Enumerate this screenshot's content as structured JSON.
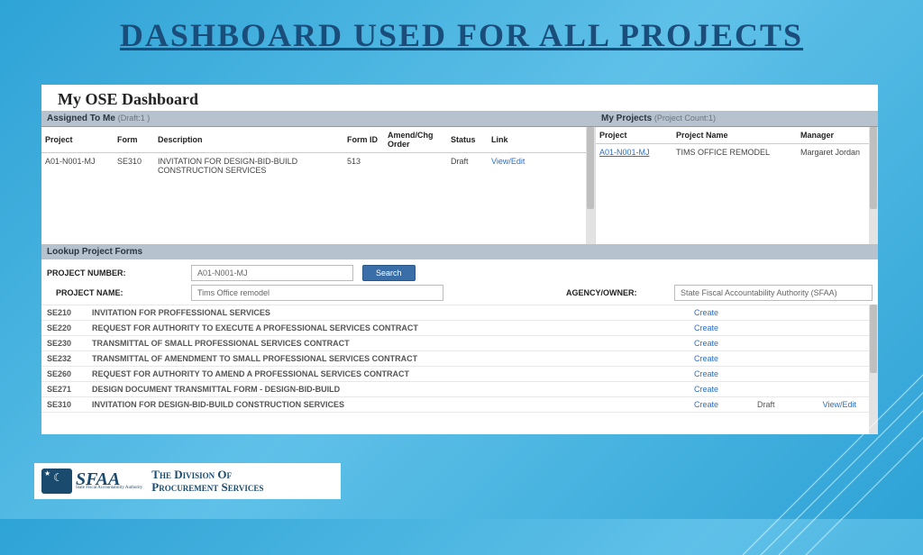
{
  "slide_title": "DASHBOARD USED FOR ALL PROJECTS",
  "dashboard_title": "My OSE Dashboard",
  "assigned": {
    "header": "Assigned To Me",
    "header_muted": "(Draft:1  )",
    "cols": [
      "Project",
      "Form",
      "Description",
      "Form ID",
      "Amend/Chg Order",
      "Status",
      "Link"
    ],
    "rows": [
      {
        "project": "A01-N001-MJ",
        "form": "SE310",
        "description": "INVITATION FOR DESIGN-BID-BUILD CONSTRUCTION SERVICES",
        "form_id": "513",
        "amend": "",
        "status": "Draft",
        "link": "View/Edit"
      }
    ]
  },
  "myprojects": {
    "header": "My Projects",
    "header_muted": "(Project Count:1)",
    "cols": [
      "Project",
      "Project Name",
      "Manager"
    ],
    "rows": [
      {
        "project": "A01-N001-MJ",
        "name": "TIMS OFFICE REMODEL",
        "manager": "Margaret Jordan"
      }
    ]
  },
  "lookup": {
    "header": "Lookup Project Forms",
    "labels": {
      "project_number": "PROJECT NUMBER:",
      "project_name": "PROJECT NAME:",
      "agency_owner": "AGENCY/OWNER:"
    },
    "values": {
      "project_number": "A01-N001-MJ",
      "project_name": "Tims Office remodel",
      "agency_owner": "State Fiscal Accountability Authority (SFAA)"
    },
    "search_label": "Search"
  },
  "forms": [
    {
      "code": "SE210",
      "desc": "INVITATION FOR PROFFESSIONAL SERVICES",
      "action": "Create",
      "status": "",
      "view": ""
    },
    {
      "code": "SE220",
      "desc": "REQUEST FOR AUTHORITY TO EXECUTE A PROFESSIONAL SERVICES CONTRACT",
      "action": "Create",
      "status": "",
      "view": ""
    },
    {
      "code": "SE230",
      "desc": "TRANSMITTAL OF SMALL PROFESSIONAL SERVICES CONTRACT",
      "action": "Create",
      "status": "",
      "view": ""
    },
    {
      "code": "SE232",
      "desc": "TRANSMITTAL OF AMENDMENT TO SMALL PROFESSIONAL SERVICES CONTRACT",
      "action": "Create",
      "status": "",
      "view": ""
    },
    {
      "code": "SE260",
      "desc": "REQUEST FOR AUTHORITY TO AMEND A PROFESSIONAL SERVICES CONTRACT",
      "action": "Create",
      "status": "",
      "view": ""
    },
    {
      "code": "SE271",
      "desc": "DESIGN DOCUMENT TRANSMITTAL FORM - DESIGN-BID-BUILD",
      "action": "Create",
      "status": "",
      "view": ""
    },
    {
      "code": "SE310",
      "desc": "INVITATION FOR DESIGN-BID-BUILD CONSTRUCTION SERVICES",
      "action": "Create",
      "status": "Draft",
      "view": "View/Edit"
    },
    {
      "code": "",
      "desc": "",
      "action": "",
      "status": "",
      "view": ""
    }
  ],
  "footer": {
    "brand": "SFAA",
    "brand_sub": "State Fiscal Accountability Authority",
    "division_line1": "The Division Of",
    "division_line2": "Procurement Services"
  }
}
